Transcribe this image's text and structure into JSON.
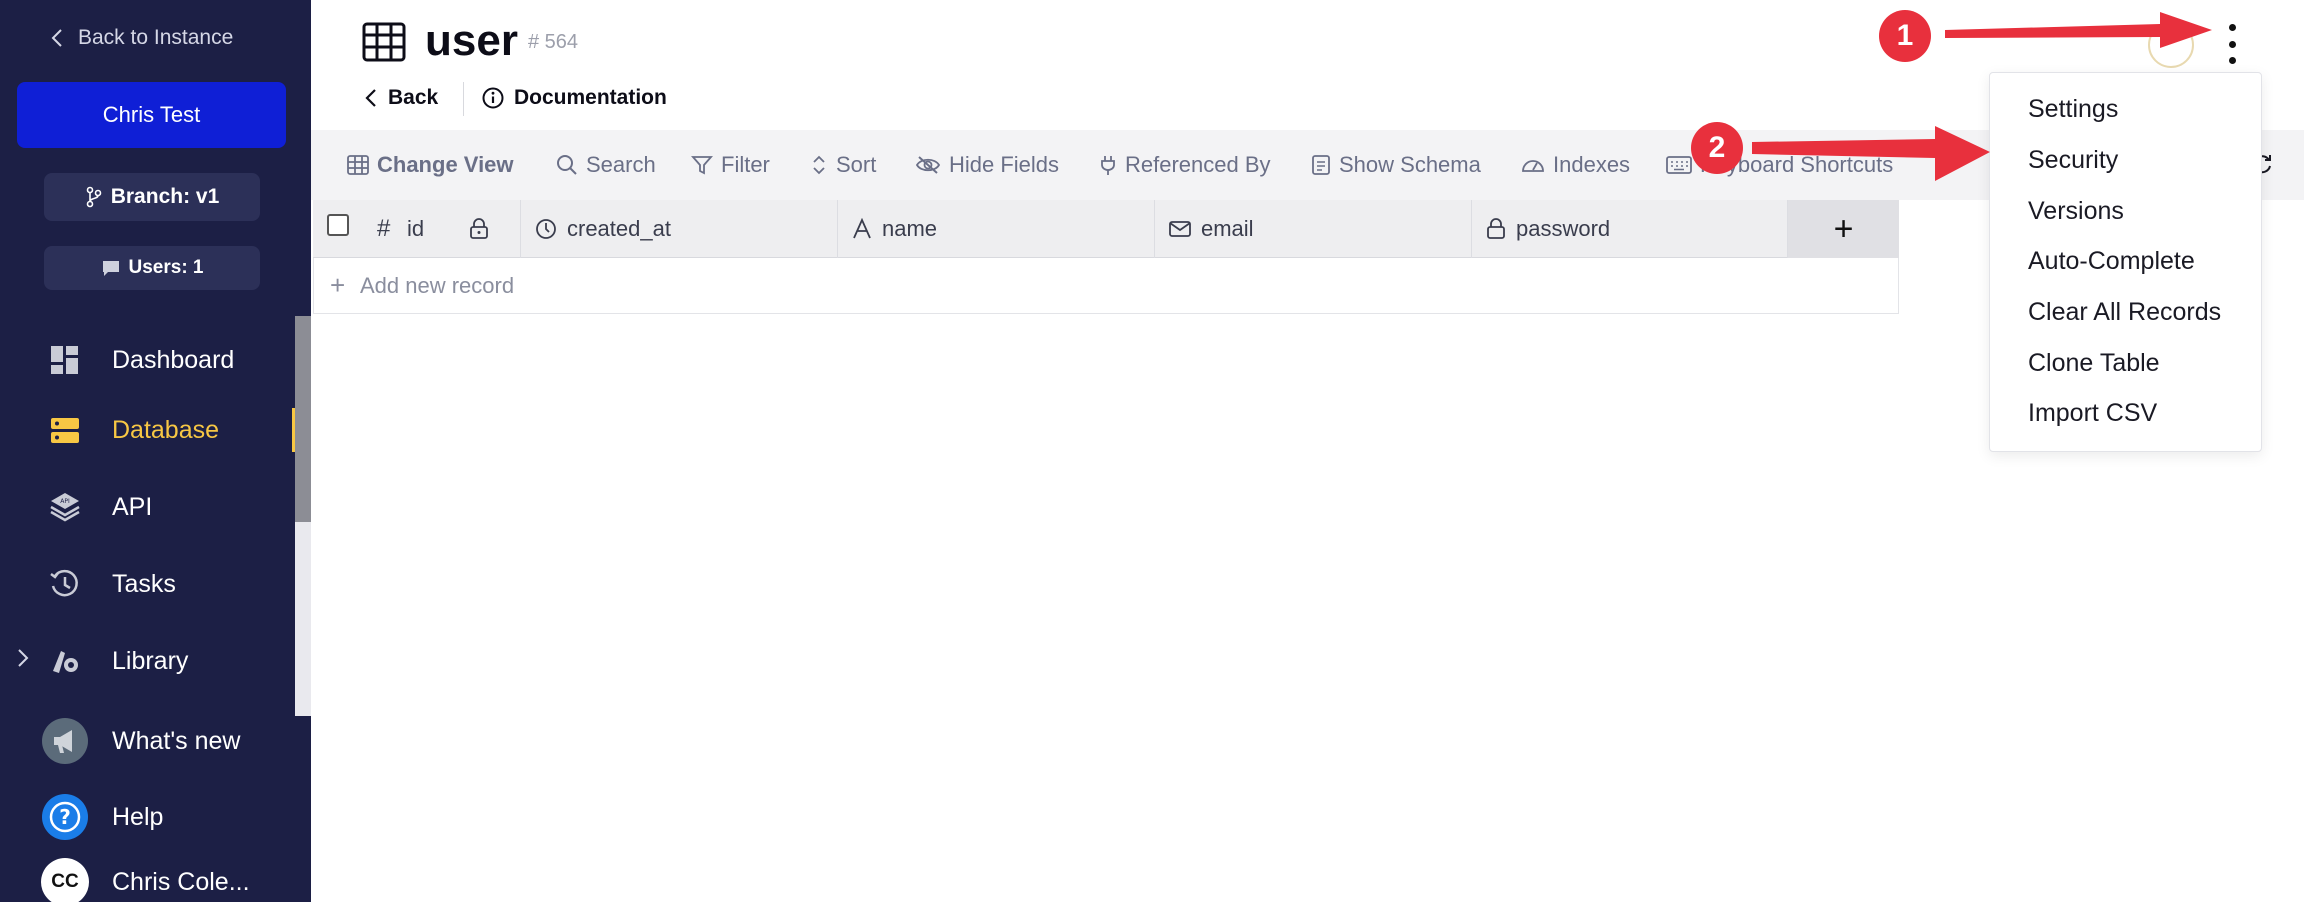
{
  "sidebar": {
    "back_label": "Back to Instance",
    "instance_name": "Chris Test",
    "branch": "Branch: v1",
    "users": "Users: 1",
    "items": [
      {
        "label": "Dashboard",
        "icon": "dashboard-icon"
      },
      {
        "label": "Database",
        "icon": "database-icon",
        "active": true
      },
      {
        "label": "API",
        "icon": "api-icon"
      },
      {
        "label": "Tasks",
        "icon": "history-icon"
      },
      {
        "label": "Library",
        "icon": "library-icon"
      },
      {
        "label": "What's new",
        "icon": "megaphone-icon"
      },
      {
        "label": "Help",
        "icon": "help-icon"
      }
    ],
    "user": {
      "initials": "CC",
      "name": "Chris Cole..."
    }
  },
  "header": {
    "title": "user",
    "table_id": "# 564",
    "back": "Back",
    "documentation": "Documentation"
  },
  "toolbar": {
    "items": [
      "Change View",
      "Search",
      "Filter",
      "Sort",
      "Hide Fields",
      "Referenced By",
      "Show Schema",
      "Indexes",
      "Keyboard Shortcuts"
    ]
  },
  "grid": {
    "columns": [
      "id",
      "created_at",
      "name",
      "email",
      "password"
    ],
    "add_record": "Add new record",
    "add_column": "+"
  },
  "menu": {
    "items": [
      "Settings",
      "Security",
      "Versions",
      "Auto-Complete",
      "Clear All Records",
      "Clone Table",
      "Import CSV"
    ]
  },
  "annotations": {
    "step1": "1",
    "step2": "2",
    "color": "#e8303d"
  },
  "colors": {
    "sidebar_bg": "#1c1f45",
    "instance_btn": "#0f1fd6",
    "active": "#f7c744"
  }
}
